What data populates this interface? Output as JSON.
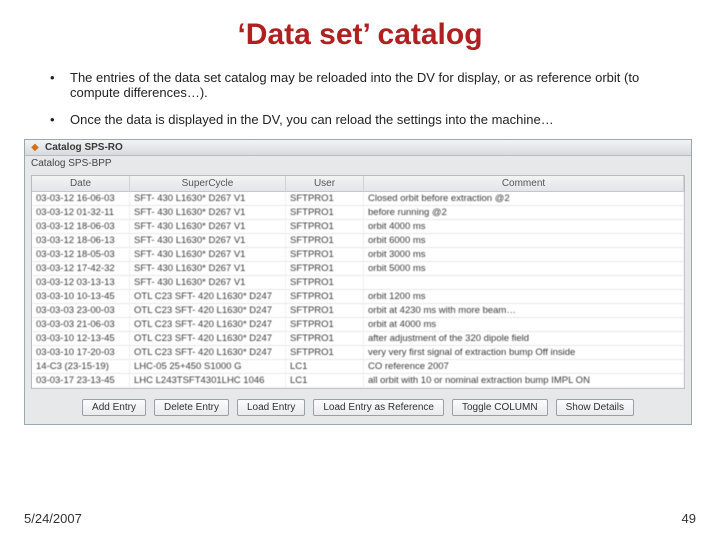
{
  "title": "‘Data set’ catalog",
  "bullets": [
    "The  entries of the data set catalog may be reloaded into the DV for display, or as reference orbit (to compute differences…).",
    "Once the data is displayed in the DV, you can reload the settings into the machine…"
  ],
  "app": {
    "window_title": "Catalog SPS-RO",
    "catalog_label": "Catalog SPS-BPP",
    "columns": [
      "Date",
      "SuperCycle",
      "User",
      "Comment"
    ],
    "rows": [
      {
        "date": "03-03-12 16-06-03",
        "cycle": "SFT- 430 L1630* D267 V1",
        "user": "SFTPRO1",
        "comment": "Closed orbit before extraction @2"
      },
      {
        "date": "03-03-12 01-32-11",
        "cycle": "SFT- 430 L1630* D267 V1",
        "user": "SFTPRO1",
        "comment": "before running @2"
      },
      {
        "date": "03-03-12 18-06-03",
        "cycle": "SFT- 430 L1630* D267 V1",
        "user": "SFTPRO1",
        "comment": "orbit 4000 ms"
      },
      {
        "date": "03-03-12 18-06-13",
        "cycle": "SFT- 430 L1630* D267 V1",
        "user": "SFTPRO1",
        "comment": "orbit 6000 ms"
      },
      {
        "date": "03-03-12 18-05-03",
        "cycle": "SFT- 430 L1630* D267 V1",
        "user": "SFTPRO1",
        "comment": "orbit 3000 ms"
      },
      {
        "date": "03-03-12 17-42-32",
        "cycle": "SFT- 430 L1630* D267 V1",
        "user": "SFTPRO1",
        "comment": "orbit 5000 ms"
      },
      {
        "date": "03-03-12 03-13-13",
        "cycle": "SFT- 430 L1630* D267 V1",
        "user": "SFTPRO1",
        "comment": ""
      },
      {
        "date": "03-03-10 10-13-45",
        "cycle": "OTL C23 SFT- 420 L1630* D247",
        "user": "SFTPRO1",
        "comment": "orbit 1200 ms"
      },
      {
        "date": "03-03-03 23-00-03",
        "cycle": "OTL C23 SFT- 420 L1630* D247",
        "user": "SFTPRO1",
        "comment": "orbit at 4230 ms with more beam…"
      },
      {
        "date": "03-03-03 21-06-03",
        "cycle": "OTL C23 SFT- 420 L1630* D247",
        "user": "SFTPRO1",
        "comment": "orbit at 4000 ms"
      },
      {
        "date": "03-03-10 12-13-45",
        "cycle": "OTL C23 SFT- 420 L1630* D247",
        "user": "SFTPRO1",
        "comment": "after adjustment of the 320 dipole field"
      },
      {
        "date": "03-03-10 17-20-03",
        "cycle": "OTL C23 SFT- 420 L1630* D247",
        "user": "SFTPRO1",
        "comment": "very very first signal of extraction bump Off inside"
      },
      {
        "date": "14-C3 (23-15-19)",
        "cycle": "LHC-05 25+450  S1000 G",
        "user": "LC1",
        "comment": "CO reference 2007"
      },
      {
        "date": "03-03-17 23-13-45",
        "cycle": "LHC L243TSFT4301LHC 1046",
        "user": "LC1",
        "comment": "all orbit with 10 or nominal extraction bump IMPL ON"
      }
    ],
    "buttons": [
      "Add Entry",
      "Delete Entry",
      "Load Entry",
      "Load Entry as Reference",
      "Toggle COLUMN",
      "Show Details"
    ]
  },
  "footer": {
    "date": "5/24/2007",
    "page": "49"
  }
}
